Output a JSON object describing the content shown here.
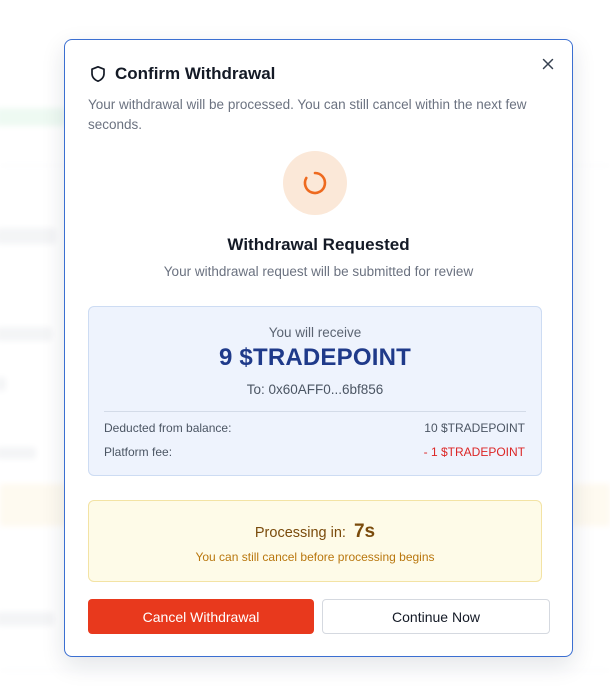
{
  "modal": {
    "title": "Confirm Withdrawal",
    "description": "Your withdrawal will be processed. You can still cancel within the next few seconds.",
    "status_title": "Withdrawal Requested",
    "status_subtitle": "Your withdrawal request will be submitted for review",
    "receive": {
      "label": "You will receive",
      "amount": "9 $TRADEPOINT",
      "to": "To: 0x60AFF0...6bf856",
      "deducted_label": "Deducted from balance:",
      "deducted_value": "10 $TRADEPOINT",
      "fee_label": "Platform fee:",
      "fee_value": "- 1 $TRADEPOINT"
    },
    "processing": {
      "label": "Processing in:",
      "seconds": "7s",
      "note": "You can still cancel before processing begins"
    },
    "buttons": {
      "cancel": "Cancel Withdrawal",
      "continue": "Continue Now"
    },
    "icons": {
      "title": "shield-icon",
      "close": "close-icon",
      "status": "spinner-icon"
    },
    "colors": {
      "accent": "#e8391d",
      "primary_text": "#1f3a8a",
      "warning_text": "#7a4b0c",
      "negative": "#dc2626"
    }
  }
}
